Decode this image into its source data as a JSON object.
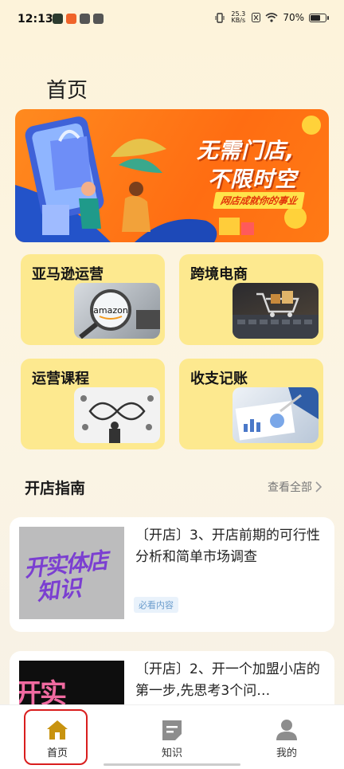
{
  "status_bar": {
    "time": "12:13",
    "net_speed_value": "25.3",
    "net_speed_unit": "KB/s",
    "battery_text": "70%",
    "battery_level": 0.7
  },
  "page": {
    "title": "首页"
  },
  "banner": {
    "line1": "无需门店,",
    "line2": "不限时空",
    "tagline": "网店成就你的事业"
  },
  "categories": [
    {
      "label": "亚马逊运营",
      "image_text": "amazon"
    },
    {
      "label": "跨境电商"
    },
    {
      "label": "运营课程"
    },
    {
      "label": "收支记账"
    }
  ],
  "guide": {
    "section_title": "开店指南",
    "view_all_label": "查看全部",
    "items": [
      {
        "title": "〔开店〕3、开店前期的可行性分析和简单市场调查",
        "thumb_text_1": "开实体店",
        "thumb_text_2": "知识",
        "tag": "必看内容"
      },
      {
        "title": "〔开店〕2、开一个加盟小店的第一步,先思考3个问…",
        "thumb_text_1": "开实"
      }
    ]
  },
  "tabbar": {
    "items": [
      {
        "label": "首页",
        "icon": "home-icon",
        "active": true
      },
      {
        "label": "知识",
        "icon": "document-icon",
        "active": false
      },
      {
        "label": "我的",
        "icon": "person-icon",
        "active": false
      }
    ]
  },
  "colors": {
    "accent": "#c8930f",
    "card_bg": "#fde98f",
    "banner_orange": "#ff7a15",
    "highlight_red": "#d91e1e"
  }
}
